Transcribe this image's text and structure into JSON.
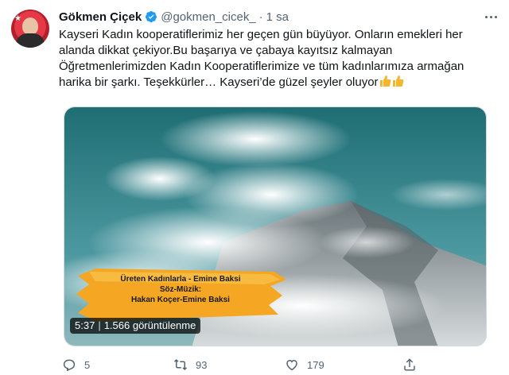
{
  "author": {
    "name": "Gökmen Çiçek",
    "handle": "@gokmen_cicek_",
    "separator": "·",
    "time": "1 sa"
  },
  "tweet": {
    "text": "Kayseri Kadın kooperatiflerimiz her geçen gün büyüyor. Onların emekleri her alanda dikkat çekiyor.Bu başarıya ve çabaya kayıtsız kalmayan Öğretmenlerimizden Kadın Kooperatiflerimize ve tüm kadınlarımıza armağan harika bir şarkı. Teşekkürler… Kayseri’de güzel şeyler oluyor"
  },
  "video": {
    "caption_line1": "Üreten Kadınlarla - Emine Baksi",
    "caption_line2": "Söz-Müzik:",
    "caption_line3": "Hakan Koçer-Emine Baksi",
    "duration": "5:37",
    "views": "1.566 görüntülenme"
  },
  "actions": {
    "reply_count": "5",
    "retweet_count": "93",
    "like_count": "179"
  },
  "colors": {
    "verified": "#1d9bf0",
    "muted": "#536471",
    "banner": "#f5a623"
  }
}
